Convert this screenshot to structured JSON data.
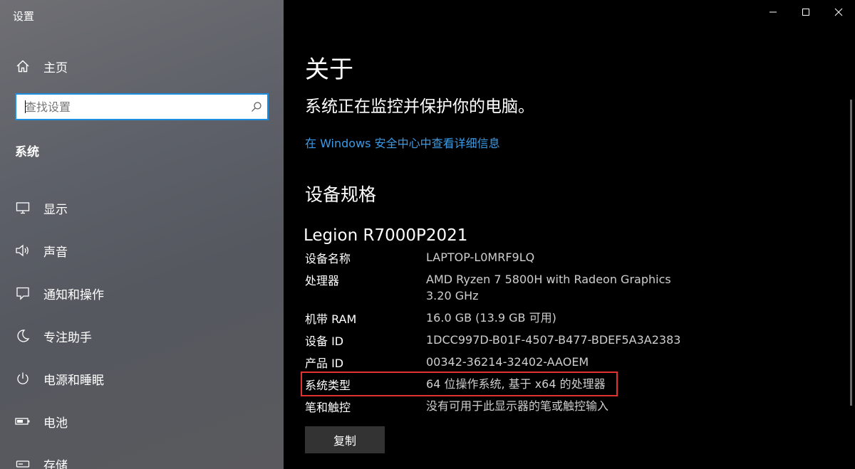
{
  "window": {
    "title": "设置"
  },
  "sidebar": {
    "home_label": "主页",
    "search_placeholder": "查找设置",
    "section_heading": "系统",
    "items": [
      {
        "label": "显示",
        "icon": "monitor-icon"
      },
      {
        "label": "声音",
        "icon": "speaker-icon"
      },
      {
        "label": "通知和操作",
        "icon": "notification-icon"
      },
      {
        "label": "专注助手",
        "icon": "moon-icon"
      },
      {
        "label": "电源和睡眠",
        "icon": "power-icon"
      },
      {
        "label": "电池",
        "icon": "battery-icon"
      },
      {
        "label": "存储",
        "icon": "storage-icon"
      }
    ]
  },
  "main": {
    "title": "关于",
    "protect_text": "系统正在监控并保护你的电脑。",
    "security_link": "在 Windows 安全中心中查看详细信息",
    "specs_heading": "设备规格",
    "device_model": "Legion R7000P2021",
    "specs": [
      {
        "label": "设备名称",
        "value": "LAPTOP-L0MRF9LQ"
      },
      {
        "label": "处理器",
        "value": "AMD Ryzen 7 5800H with Radeon Graphics",
        "value2": "3.20 GHz"
      },
      {
        "label": "机带 RAM",
        "value": "16.0 GB (13.9 GB 可用)"
      },
      {
        "label": "设备 ID",
        "value": "1DCC997D-B01F-4507-B477-BDEF5A3A2383"
      },
      {
        "label": "产品 ID",
        "value": "00342-36214-32402-AAOEM"
      },
      {
        "label": "系统类型",
        "value": "64 位操作系统, 基于 x64 的处理器"
      },
      {
        "label": "笔和触控",
        "value": "没有可用于此显示器的笔或触控输入"
      }
    ],
    "copy_button": "复制"
  },
  "colors": {
    "accent": "#1e8fe0",
    "link": "#3a9be8",
    "highlight": "#e0322e",
    "background": "#000000"
  }
}
